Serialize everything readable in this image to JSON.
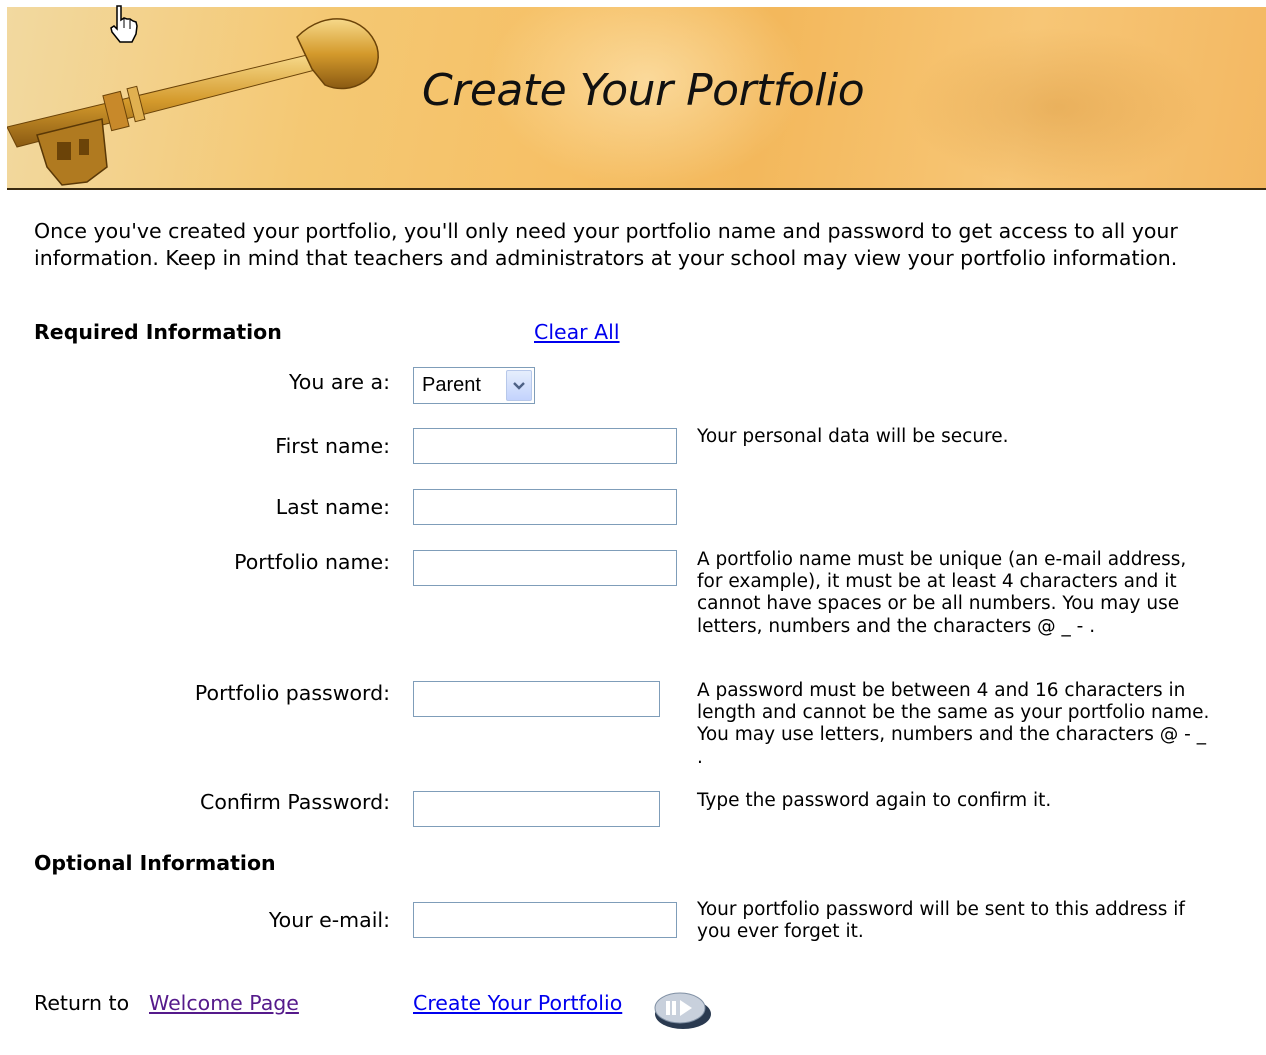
{
  "banner": {
    "title": "Create Your Portfolio"
  },
  "intro": "Once you've created your portfolio, you'll only need your portfolio name and password to get access to all your information. Keep in mind that teachers and administrators at your school may view your portfolio information.",
  "required": {
    "heading": "Required Information",
    "clear_all": "Clear All",
    "role": {
      "label": "You are a:",
      "selected": "Parent"
    },
    "first_name": {
      "label": "First name:",
      "value": ""
    },
    "last_name": {
      "label": "Last name:",
      "value": ""
    },
    "portfolio_name": {
      "label": "Portfolio name:",
      "value": ""
    },
    "portfolio_password": {
      "label": "Portfolio password:",
      "value": ""
    },
    "confirm_password": {
      "label": "Confirm Password:",
      "value": ""
    },
    "hints": {
      "first_name": "Your personal data will be secure.",
      "portfolio_name": "A portfolio name must be unique (an e-mail address, for example), it must be at least 4 characters and it cannot have spaces or be all numbers. You may use letters, numbers and the characters @ _ - .",
      "portfolio_password": "A password must be between 4 and 16 characters in length and cannot be the same as your portfolio name. You may use letters, numbers and the characters @ - _ .",
      "confirm_password": "Type the password again to confirm it."
    }
  },
  "optional": {
    "heading": "Optional Information",
    "email": {
      "label": "Your e-mail:",
      "value": ""
    },
    "email_hint": "Your portfolio password will be sent to this address if you ever forget it."
  },
  "footer": {
    "return_prefix": "Return to",
    "welcome_link": "Welcome Page",
    "create_link": "Create Your Portfolio"
  },
  "colors": {
    "link": "#0000ee",
    "visited_link": "#551a8b",
    "banner": "#f6c066"
  },
  "icons": [
    "key-image",
    "hand-cursor-icon",
    "go-arrow-icon",
    "chevron-down-icon"
  ]
}
